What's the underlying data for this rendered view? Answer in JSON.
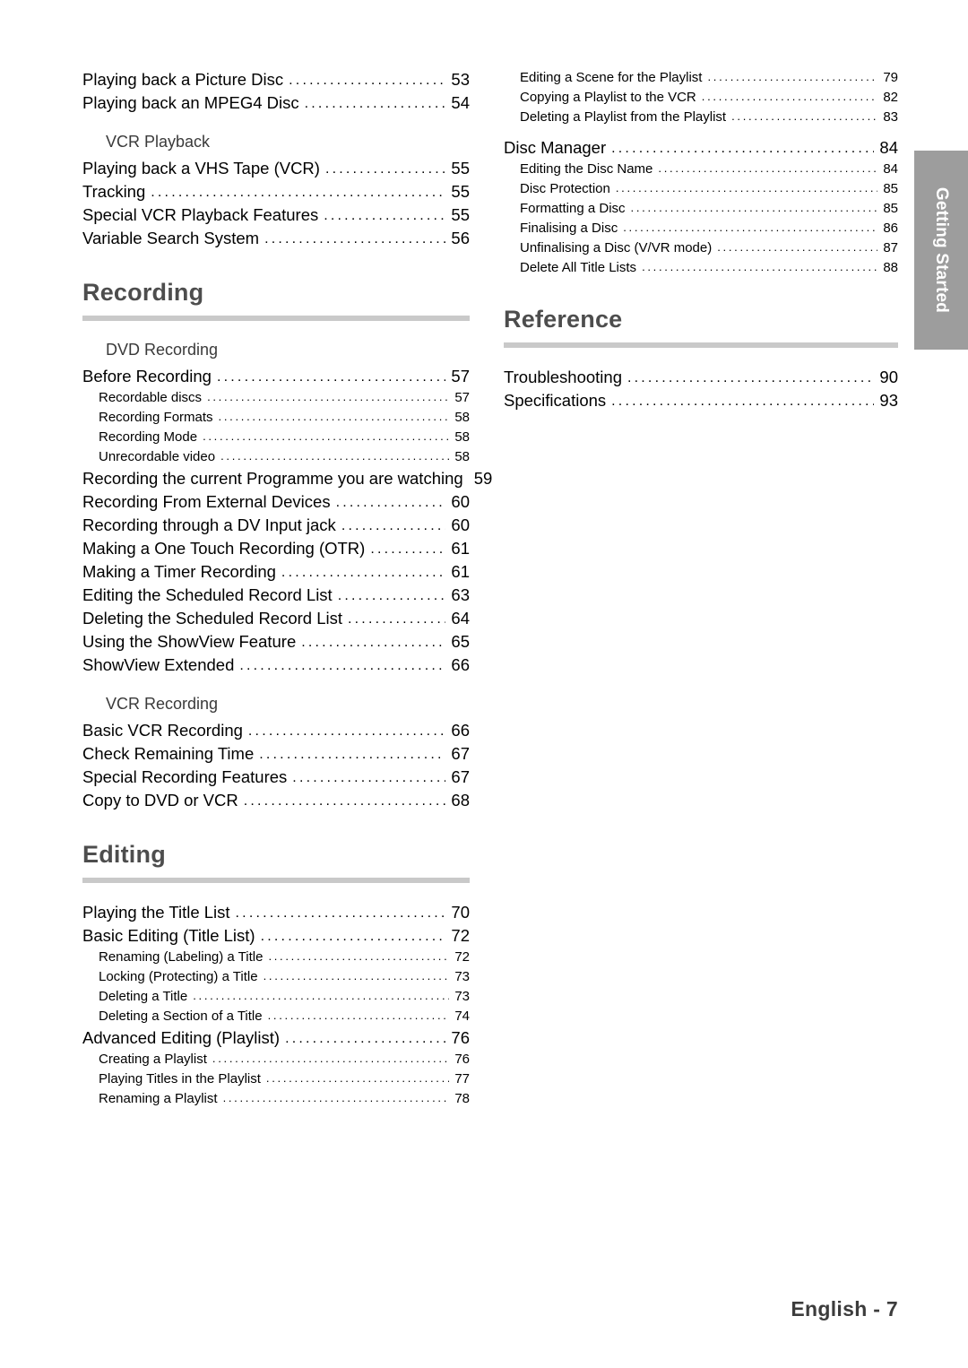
{
  "side_tab": {
    "label": "Getting Started"
  },
  "footer": {
    "text": "English - 7"
  },
  "left_column": {
    "top_entries": [
      {
        "label": "Playing back a Picture Disc",
        "page": "53"
      },
      {
        "label": "Playing back an MPEG4 Disc",
        "page": "54"
      }
    ],
    "vcr_playback_group": {
      "title": "VCR Playback"
    },
    "vcr_playback_entries": [
      {
        "label": "Playing back a VHS Tape (VCR)",
        "page": "55"
      },
      {
        "label": "Tracking",
        "page": "55"
      },
      {
        "label": "Special VCR Playback Features",
        "page": "55"
      },
      {
        "label": "Variable Search System",
        "page": "56"
      }
    ],
    "recording_section": {
      "title": "Recording"
    },
    "dvd_recording_group": {
      "title": "DVD Recording"
    },
    "dvd_recording_entries": [
      {
        "label": "Before Recording",
        "page": "57",
        "level": 1
      },
      {
        "label": "Recordable discs",
        "page": "57",
        "level": 2
      },
      {
        "label": "Recording Formats",
        "page": "58",
        "level": 2
      },
      {
        "label": "Recording Mode",
        "page": "58",
        "level": 2
      },
      {
        "label": "Unrecordable video",
        "page": "58",
        "level": 2
      },
      {
        "label": "Recording the current Programme you are watching",
        "page": "59",
        "level": 1
      },
      {
        "label": "Recording From External Devices",
        "page": "60",
        "level": 1
      },
      {
        "label": "Recording through a DV Input jack",
        "page": "60",
        "level": 1
      },
      {
        "label": "Making a One Touch Recording (OTR)",
        "page": "61",
        "level": 1
      },
      {
        "label": "Making a Timer Recording",
        "page": "61",
        "level": 1
      },
      {
        "label": "Editing the Scheduled Record List",
        "page": "63",
        "level": 1
      },
      {
        "label": "Deleting the Scheduled Record List",
        "page": "64",
        "level": 1
      },
      {
        "label": "Using the ShowView Feature",
        "page": "65",
        "level": 1
      },
      {
        "label": "ShowView Extended",
        "page": "66",
        "level": 1
      }
    ],
    "vcr_recording_group": {
      "title": "VCR Recording"
    },
    "vcr_recording_entries": [
      {
        "label": "Basic VCR Recording",
        "page": "66"
      },
      {
        "label": "Check Remaining Time",
        "page": "67"
      },
      {
        "label": "Special Recording Features",
        "page": "67"
      },
      {
        "label": "Copy to DVD or VCR",
        "page": "68"
      }
    ],
    "editing_section": {
      "title": "Editing"
    },
    "editing_entries": [
      {
        "label": "Playing the Title List",
        "page": "70",
        "level": 1
      },
      {
        "label": "Basic Editing (Title List)",
        "page": "72",
        "level": 1
      },
      {
        "label": "Renaming (Labeling) a Title",
        "page": "72",
        "level": 2
      },
      {
        "label": "Locking (Protecting) a Title",
        "page": "73",
        "level": 2
      },
      {
        "label": "Deleting a Title",
        "page": "73",
        "level": 2
      },
      {
        "label": "Deleting a Section of a Title",
        "page": "74",
        "level": 2
      },
      {
        "label": "Advanced Editing (Playlist)",
        "page": "76",
        "level": 1
      },
      {
        "label": "Creating a Playlist",
        "page": "76",
        "level": 2
      },
      {
        "label": "Playing Titles in the Playlist",
        "page": "77",
        "level": 2
      },
      {
        "label": "Renaming a Playlist",
        "page": "78",
        "level": 2
      }
    ]
  },
  "right_column": {
    "playlist_entries": [
      {
        "label": "Editing a Scene for the Playlist",
        "page": "79",
        "level": 2
      },
      {
        "label": "Copying a Playlist to the VCR",
        "page": "82",
        "level": 2
      },
      {
        "label": "Deleting a Playlist from the Playlist",
        "page": "83",
        "level": 2
      }
    ],
    "disc_manager_entries": [
      {
        "label": "Disc Manager",
        "page": "84",
        "level": 1
      },
      {
        "label": "Editing the Disc Name",
        "page": "84",
        "level": 2
      },
      {
        "label": "Disc Protection",
        "page": "85",
        "level": 2
      },
      {
        "label": "Formatting a Disc",
        "page": "85",
        "level": 2
      },
      {
        "label": "Finalising a Disc",
        "page": "86",
        "level": 2
      },
      {
        "label": "Unfinalising a Disc (V/VR mode)",
        "page": "87",
        "level": 2
      },
      {
        "label": "Delete All Title Lists",
        "page": "88",
        "level": 2
      }
    ],
    "reference_section": {
      "title": "Reference"
    },
    "reference_entries": [
      {
        "label": "Troubleshooting",
        "page": "90"
      },
      {
        "label": "Specifications",
        "page": "93"
      }
    ]
  }
}
